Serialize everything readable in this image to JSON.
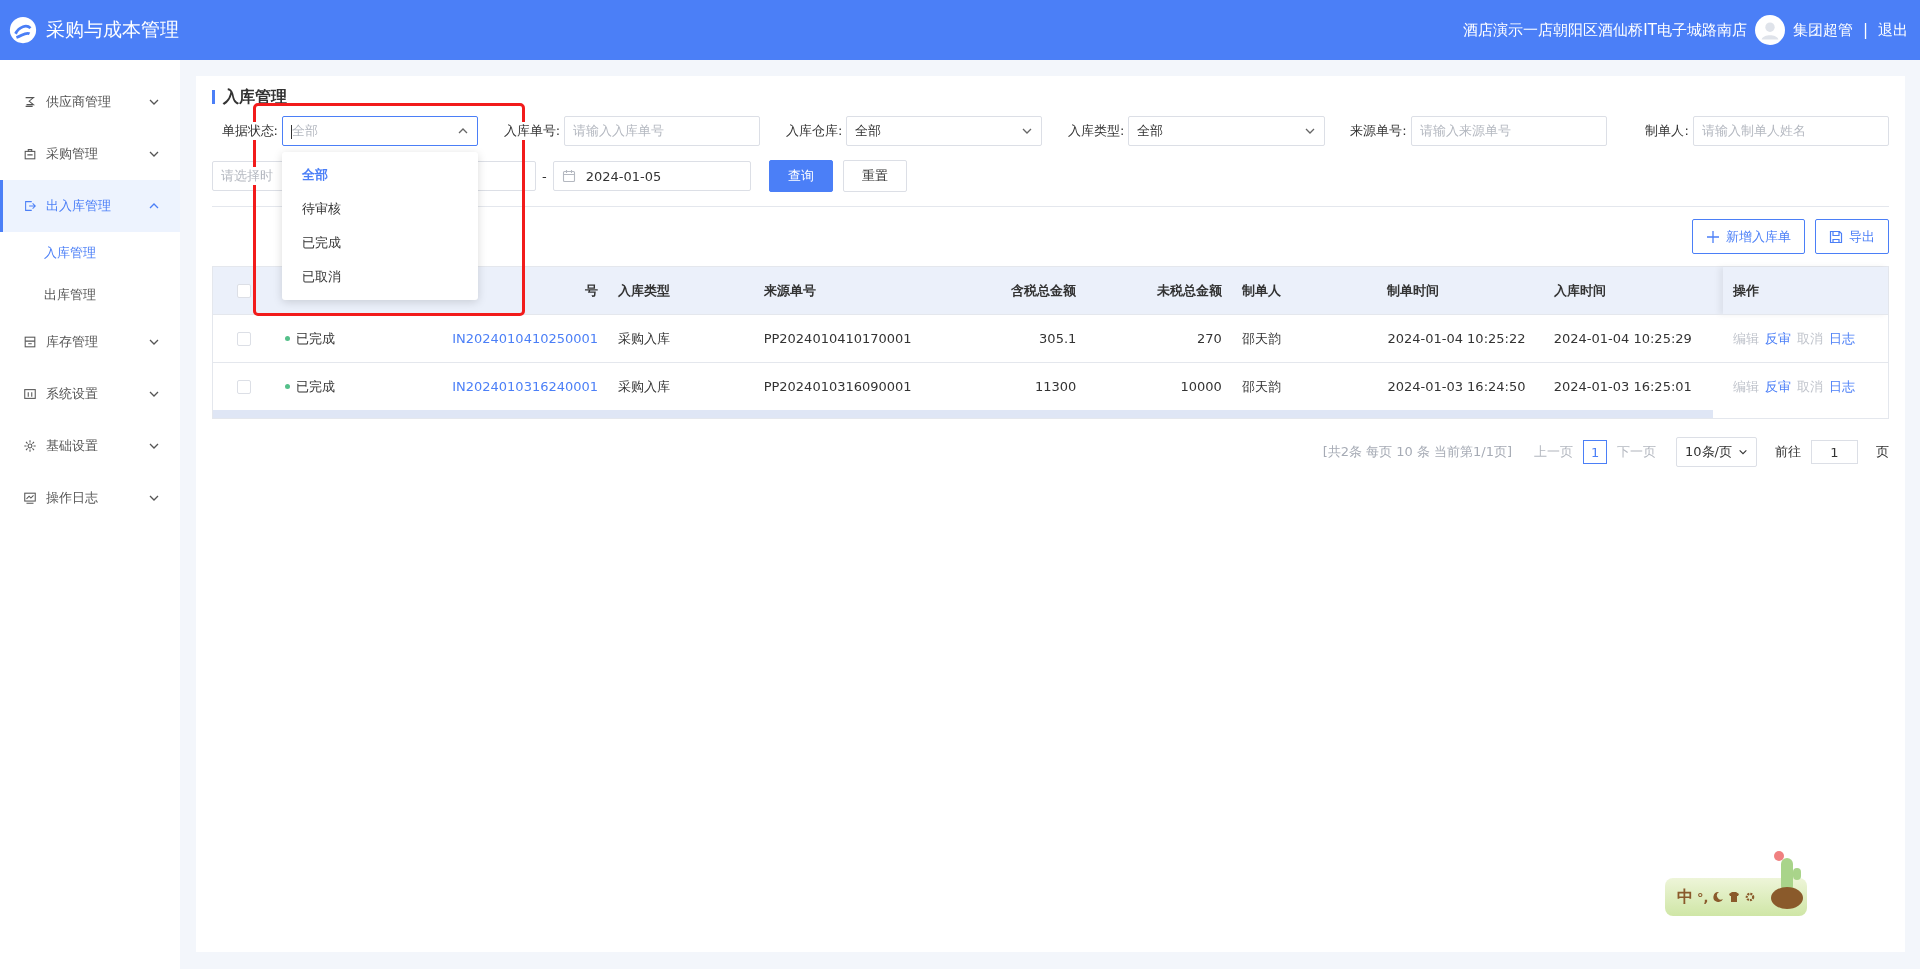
{
  "header": {
    "title": "采购与成本管理",
    "store": "酒店演示一店朝阳区酒仙桥IT电子城路南店",
    "user": "集团超管",
    "separator": "|",
    "logout": "退出"
  },
  "sidebar": [
    {
      "label": "供应商管理",
      "expanded": false,
      "selected": false
    },
    {
      "label": "采购管理",
      "expanded": false,
      "selected": false
    },
    {
      "label": "出入库管理",
      "expanded": true,
      "selected": true,
      "children": [
        {
          "label": "入库管理",
          "selected": true
        },
        {
          "label": "出库管理",
          "selected": false
        }
      ]
    },
    {
      "label": "库存管理",
      "expanded": false,
      "selected": false
    },
    {
      "label": "系统设置",
      "expanded": false,
      "selected": false
    },
    {
      "label": "基础设置",
      "expanded": false,
      "selected": false
    },
    {
      "label": "操作日志",
      "expanded": false,
      "selected": false
    }
  ],
  "page_title": "入库管理",
  "filters": [
    {
      "label": "单据状态:",
      "kind": "select",
      "placeholder": "全部",
      "open": true,
      "options": [
        {
          "label": "全部",
          "selected": true
        },
        {
          "label": "待审核",
          "selected": false
        },
        {
          "label": "已完成",
          "selected": false
        },
        {
          "label": "已取消",
          "selected": false
        }
      ]
    },
    {
      "label": "入库单号:",
      "kind": "input",
      "placeholder": "请输入入库单号"
    },
    {
      "label": "入库仓库:",
      "kind": "select",
      "value": "全部",
      "open": false
    },
    {
      "label": "入库类型:",
      "kind": "select",
      "value": "全部",
      "open": false
    },
    {
      "label": "来源单号:",
      "kind": "input",
      "placeholder": "请输入来源单号"
    },
    {
      "label": "制单人:",
      "kind": "input",
      "placeholder": "请输入制单人姓名"
    }
  ],
  "date_range": {
    "start_placeholder": "请选择时",
    "separator": "-",
    "end_value": "2024-01-05"
  },
  "filter_buttons": [
    {
      "label": "查询",
      "primary": true
    },
    {
      "label": "重置",
      "primary": false
    }
  ],
  "actions": [
    {
      "label": "新增入库单"
    },
    {
      "label": "导出"
    }
  ],
  "table": {
    "header_checked": false,
    "columns": [
      {},
      {
        "label": "号"
      },
      {
        "label": "入库类型"
      },
      {
        "label": "来源单号"
      },
      {
        "label": "含税总金额"
      },
      {
        "label": "未税总金额"
      },
      {
        "label": "制单人"
      },
      {
        "label": "制单时间"
      },
      {
        "label": "入库时间"
      },
      {
        "label": "操作"
      }
    ],
    "rows": [
      {
        "checked": false,
        "cells": [
          "已完成",
          "IN2024010410250001",
          "采购入库",
          "PP2024010410170001",
          "305.1",
          "270",
          "邵天韵",
          "2024-01-04 10:25:22",
          "2024-01-04 10:25:29"
        ],
        "actions": [
          {
            "label": "编辑",
            "disabled": true
          },
          {
            "label": "反审",
            "disabled": false
          },
          {
            "label": "取消",
            "disabled": true
          },
          {
            "label": "日志",
            "disabled": false
          }
        ]
      },
      {
        "checked": false,
        "cells": [
          "已完成",
          "IN2024010316240001",
          "采购入库",
          "PP2024010316090001",
          "11300",
          "10000",
          "邵天韵",
          "2024-01-03 16:24:50",
          "2024-01-03 16:25:01"
        ],
        "actions": [
          {
            "label": "编辑",
            "disabled": true
          },
          {
            "label": "反审",
            "disabled": false
          },
          {
            "label": "取消",
            "disabled": true
          },
          {
            "label": "日志",
            "disabled": false
          }
        ]
      }
    ]
  },
  "pagination": {
    "summary": "[共2条 每页 10 条 当前第1/1页]",
    "prev": "上一页",
    "pages": [
      {
        "label": "1",
        "selected": true
      }
    ],
    "next": "下一页",
    "page_size": "10条/页",
    "goto_label": "前往",
    "goto_value": "1",
    "goto_suffix": "页"
  },
  "ime_toolbar": {
    "mode": "中",
    "punct": "°,"
  }
}
